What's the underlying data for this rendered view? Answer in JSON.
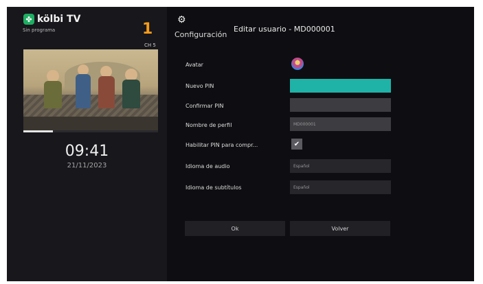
{
  "brand": {
    "name": "kölbi TV",
    "logo_icon": "clover-icon"
  },
  "channel": {
    "program": "Sin programa",
    "number": "1",
    "label": "CH 5"
  },
  "player": {
    "progress": 0.22
  },
  "clock": {
    "time": "09:41",
    "date": "21/11/2023"
  },
  "header": {
    "section": "Configuración",
    "title": "Editar usuario - MD000001",
    "icon": "gear-icon"
  },
  "form": {
    "avatar_label": "Avatar",
    "new_pin_label": "Nuevo PIN",
    "new_pin_value": "",
    "confirm_pin_label": "Confirmar PIN",
    "confirm_pin_value": "",
    "profile_name_label": "Nombre de perfil",
    "profile_name_value": "MD000001",
    "enable_pin_label": "Habilitar PIN para compr...",
    "enable_pin_checked": true,
    "audio_lang_label": "Idioma de audio",
    "audio_lang_value": "Español",
    "subtitle_lang_label": "Idioma de subtítulos",
    "subtitle_lang_value": "Español"
  },
  "buttons": {
    "ok": "Ok",
    "back": "Volver"
  },
  "colors": {
    "accent": "#1fb3a8",
    "channel": "#f59c1a",
    "brand": "#1fae62"
  }
}
